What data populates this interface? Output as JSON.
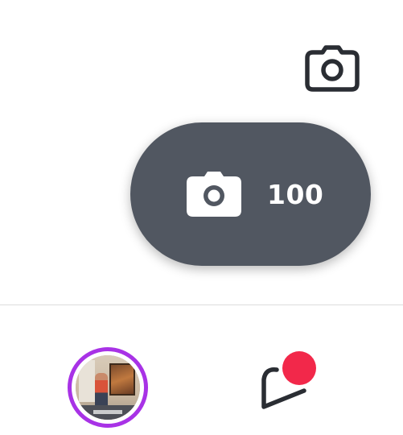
{
  "header": {
    "camera_icon": "camera-outline-icon"
  },
  "camera_pill": {
    "icon": "camera-filled-icon",
    "count": "100",
    "background_color": "#515761"
  },
  "bottom_nav": {
    "profile": {
      "icon": "avatar",
      "ring_color": "#a832e6"
    },
    "inbox": {
      "icon": "chat-bubble-icon",
      "badge_color": "#f2284a"
    }
  }
}
